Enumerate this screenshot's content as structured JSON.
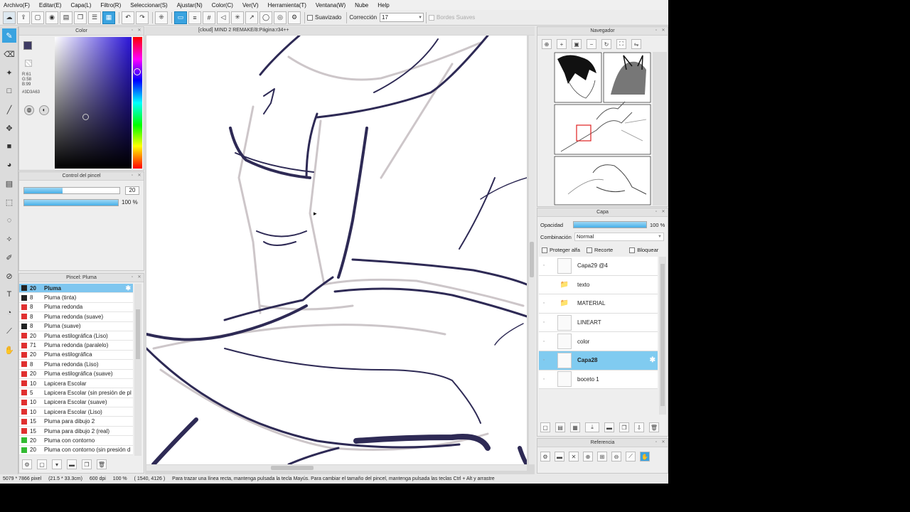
{
  "menu": [
    "Archivo(F)",
    "Editar(E)",
    "Capa(L)",
    "Filtro(R)",
    "Seleccionar(S)",
    "Ajustar(N)",
    "Color(C)",
    "Ver(V)",
    "Herramienta(T)",
    "Ventana(W)",
    "Nube",
    "Help"
  ],
  "toolbar": {
    "smoothing_label": "Suavizado",
    "correction_label": "Corrección",
    "correction_value": "17",
    "smooth_edges_label": "Bordes Suaves"
  },
  "canvas": {
    "title": "[cloud] MIND 2 REMAKE/8:Página:r34++"
  },
  "color_panel": {
    "title": "Color",
    "r": "R:61",
    "g": "G:58",
    "b": "B:99",
    "hex": "#3D3A63",
    "main_color": "#3d3a63",
    "slider_level_pct": 25
  },
  "brush_control": {
    "title": "Control del pincel",
    "size_value": "20",
    "size_level_pct": 40,
    "opacity_value": "100 %",
    "opacity_level_pct": 100
  },
  "brush_list": {
    "title": "Pincel: Pluma",
    "items": [
      {
        "size": "20",
        "name": "Pluma",
        "color": "#222222",
        "selected": true
      },
      {
        "size": "8",
        "name": "Pluma (tinta)",
        "color": "#222222"
      },
      {
        "size": "8",
        "name": "Pluma redonda",
        "color": "#e03030"
      },
      {
        "size": "8",
        "name": "Pluma redonda (suave)",
        "color": "#e03030"
      },
      {
        "size": "8",
        "name": "Pluma (suave)",
        "color": "#222222"
      },
      {
        "size": "20",
        "name": "Pluma estilográfica (Liso)",
        "color": "#e03030"
      },
      {
        "size": "71",
        "name": "Pluma redonda (paralelo)",
        "color": "#e03030"
      },
      {
        "size": "20",
        "name": "Pluma estilográfica",
        "color": "#e03030"
      },
      {
        "size": "8",
        "name": "Pluma redonda (Liso)",
        "color": "#e03030"
      },
      {
        "size": "20",
        "name": "Pluma estilográfica (suave)",
        "color": "#e03030"
      },
      {
        "size": "10",
        "name": "Lapicera Escolar",
        "color": "#e03030"
      },
      {
        "size": "5",
        "name": "Lapicera Escolar (sin presión de pl",
        "color": "#e03030"
      },
      {
        "size": "10",
        "name": "Lapicera Escolar (suave)",
        "color": "#e03030"
      },
      {
        "size": "10",
        "name": "Lapicera Escolar (Liso)",
        "color": "#e03030"
      },
      {
        "size": "15",
        "name": "Pluma para dibujo 2",
        "color": "#e03030"
      },
      {
        "size": "15",
        "name": "Pluma para dibujo 2 (real)",
        "color": "#e03030"
      },
      {
        "size": "20",
        "name": "Pluma con contorno",
        "color": "#33bb33"
      },
      {
        "size": "20",
        "name": "Pluma con contorno (sin presión d",
        "color": "#33bb33"
      }
    ]
  },
  "navigator": {
    "title": "Navegador"
  },
  "layers": {
    "title": "Capa",
    "opacity_label": "Opacidad",
    "opacity_value": "100 %",
    "opacity_level_pct": 100,
    "blend_label": "Combinación",
    "blend_value": "Normal",
    "protect_alpha": "Proteger alfa",
    "clipping": "Recorte",
    "lock": "Bloquear",
    "items": [
      {
        "name": "Capa29 @4",
        "type": "layer"
      },
      {
        "name": "texto",
        "type": "folder"
      },
      {
        "name": "MATERIAL",
        "type": "folder"
      },
      {
        "name": "LINEART",
        "type": "layer"
      },
      {
        "name": "color",
        "type": "layer"
      },
      {
        "name": "Capa28",
        "type": "layer",
        "selected": true
      },
      {
        "name": "boceto 1",
        "type": "layer"
      }
    ]
  },
  "reference": {
    "title": "Referencia"
  },
  "status": {
    "dimensions": "5079 * 7866 pixel",
    "physical": "(21.5 * 33.3cm)",
    "dpi": "600 dpi",
    "zoom": "100 %",
    "coords": "( 1540, 4126 )",
    "hint": "Para trazar una línea recta, mantenga pulsada la tecla Mayús. Para cambiar el tamaño del pincel, mantenga pulsada las teclas Ctrl + Alt y arrastre"
  }
}
